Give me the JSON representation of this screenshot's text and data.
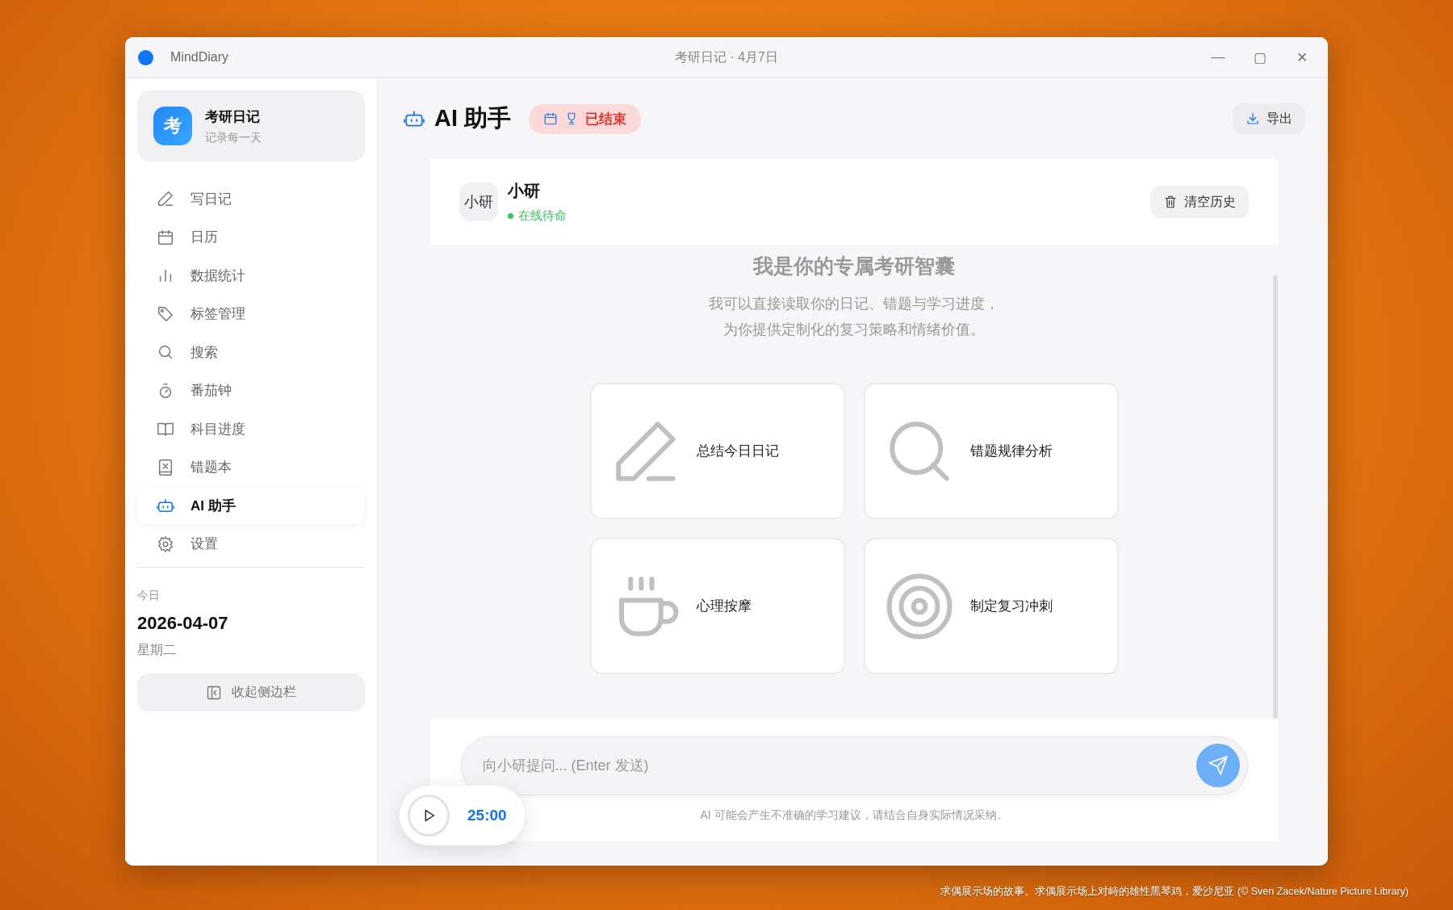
{
  "window": {
    "app_name": "MindDiary",
    "title": "考研日记 · 4月7日",
    "controls": [
      "—",
      "▢",
      "✕"
    ]
  },
  "sidebar": {
    "brand": {
      "logo": "考",
      "name": "考研日记",
      "tagline": "记录每一天"
    },
    "items": [
      {
        "label": "写日记",
        "selected": false
      },
      {
        "label": "日历",
        "selected": false
      },
      {
        "label": "数据统计",
        "selected": false
      },
      {
        "label": "标签管理",
        "selected": false
      },
      {
        "label": "搜索",
        "selected": false
      },
      {
        "label": "番茄钟",
        "selected": false
      },
      {
        "label": "科目进度",
        "selected": false
      },
      {
        "label": "错题本",
        "selected": false
      },
      {
        "label": "AI 助手",
        "selected": true
      },
      {
        "label": "设置",
        "selected": false
      }
    ],
    "today_label": "今日",
    "date": "2026-04-07",
    "weekday": "星期二",
    "collapse_button": "收起侧边栏"
  },
  "header": {
    "title": "AI 助手",
    "status_badge": "已结束",
    "export_button": "导出"
  },
  "chat": {
    "assistant": {
      "avatar_alt": "小研",
      "name": "小研",
      "status": "在线待命"
    },
    "clear_button": "清空历史",
    "welcome": {
      "title": "我是你的专属考研智囊",
      "lines": [
        "我可以直接读取你的日记、错题与学习进度，",
        "为你提供定制化的复习策略和情绪价值。"
      ]
    },
    "suggestions": [
      {
        "label": "总结今日日记"
      },
      {
        "label": "错题规律分析"
      },
      {
        "label": "心理按摩"
      },
      {
        "label": "制定复习冲刺"
      }
    ],
    "input": {
      "placeholder": "向小研提问... (Enter 发送)"
    },
    "disclaimer": "AI 可能会产生不准确的学习建议，请结合自身实际情况采纳。"
  },
  "timer": {
    "time": "25:00"
  },
  "wallpaper_caption": "求偶展示场的故事。求偶展示场上对峙的雄性黑琴鸡，爱沙尼亚 (© Sven Zacek/Nature Picture Library)"
}
